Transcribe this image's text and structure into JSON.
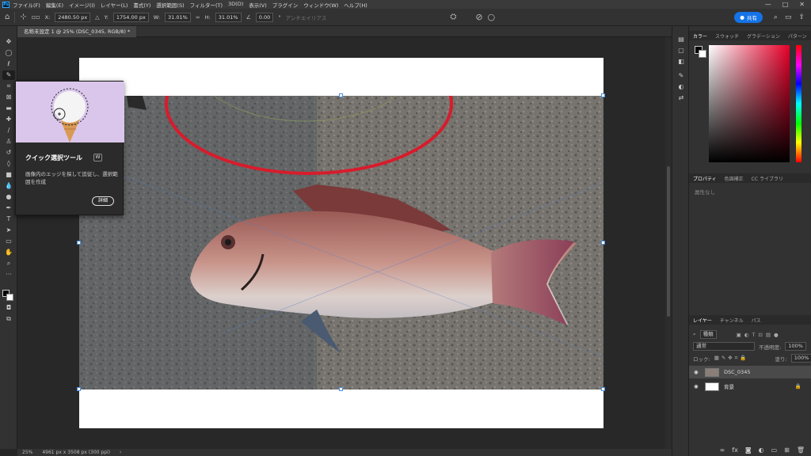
{
  "menubar": {
    "logo": "Ps",
    "items": [
      "ファイル(F)",
      "編集(E)",
      "イメージ(I)",
      "レイヤー(L)",
      "書式(Y)",
      "選択範囲(S)",
      "フィルター(T)",
      "3D(D)",
      "表示(V)",
      "プラグイン",
      "ウィンドウ(W)",
      "ヘルプ(H)"
    ],
    "min": "—",
    "max": "□",
    "close": "✕"
  },
  "options": {
    "x_label": "X:",
    "x_value": "2480.50 px",
    "y_label": "Y:",
    "y_value": "1754.00 px",
    "w_label": "W:",
    "w_value": "31.01%",
    "h_label": "H:",
    "h_value": "31.01%",
    "angle_value": "0.00",
    "angle_unit": "°",
    "antialias": "アンチエイリアス",
    "share": "共有"
  },
  "document": {
    "tab_title": "名称未設定 1 @ 25% (DSC_0345, RGB/8) *"
  },
  "tooltip": {
    "title": "クイック選択ツール",
    "shortcut": "W",
    "description": "画像内のエッジを探して追従し、選択範囲を作成",
    "more": "詳細"
  },
  "status": {
    "zoom": "25%",
    "size": "4961 px x 3508 px (300 ppi)",
    "arrow": "›"
  },
  "color_panel": {
    "tabs": [
      "カラー",
      "スウォッチ",
      "グラデーション",
      "パターン"
    ],
    "fg": "#000000",
    "bg": "#ffffff",
    "hue": "#e8002a"
  },
  "properties_panel": {
    "tabs": [
      "プロパティ",
      "色調補正",
      "CC ライブラリ"
    ],
    "empty": "属性なし"
  },
  "layers_panel": {
    "tabs": [
      "レイヤー",
      "チャンネル",
      "パス"
    ],
    "search": "種類",
    "blend_mode": "通常",
    "opacity_label": "不透明度:",
    "opacity": "100%",
    "lock_label": "ロック:",
    "fill_label": "塗り:",
    "fill": "100%",
    "layers": [
      {
        "name": "DSC_0345",
        "selected": true
      },
      {
        "name": "背景",
        "selected": false
      }
    ]
  }
}
